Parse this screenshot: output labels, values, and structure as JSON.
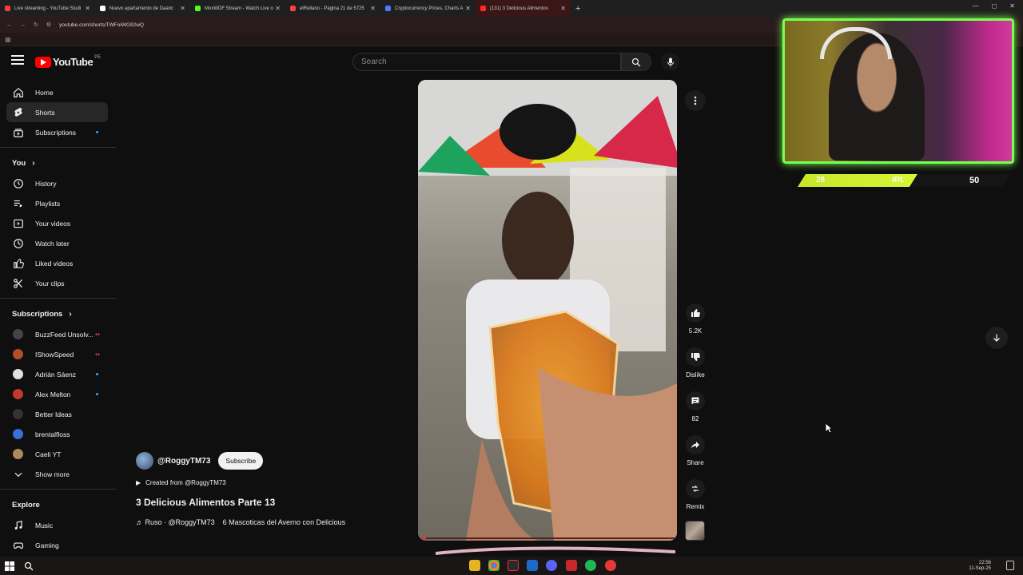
{
  "browser": {
    "tabs": [
      {
        "label": "Live streaming - YouTube Studi",
        "color": "#ff3b3b"
      },
      {
        "label": "Nuevo apartamento de Daaric",
        "color": "#ffffff"
      },
      {
        "label": "MoxWDF Stream - Watch Live o",
        "color": "#53fc18"
      },
      {
        "label": "elRellano - Página 21 de 5725",
        "color": "#ff4040"
      },
      {
        "label": "Cryptocurrency Prices, Charts A",
        "color": "#4f7cff"
      },
      {
        "label": "(131) 3 Delicious Alimentos",
        "color": "#ff2a2a"
      }
    ],
    "url": "youtube.com/shorts/TWFoiWG92wQ"
  },
  "header": {
    "logo_text": "YouTube",
    "country": "PE",
    "search_placeholder": "Search"
  },
  "sidebar": {
    "main": [
      {
        "label": "Home",
        "icon": "home-icon"
      },
      {
        "label": "Shorts",
        "icon": "shorts-icon",
        "active": true
      },
      {
        "label": "Subscriptions",
        "icon": "subscriptions-icon",
        "dot": true
      }
    ],
    "you_heading": "You",
    "you": [
      {
        "label": "History",
        "icon": "history-icon"
      },
      {
        "label": "Playlists",
        "icon": "playlists-icon"
      },
      {
        "label": "Your videos",
        "icon": "your-videos-icon"
      },
      {
        "label": "Watch later",
        "icon": "clock-icon"
      },
      {
        "label": "Liked videos",
        "icon": "thumbs-up-icon"
      },
      {
        "label": "Your clips",
        "icon": "scissors-icon"
      }
    ],
    "subs_heading": "Subscriptions",
    "subs": [
      {
        "label": "BuzzFeed Unsolv...",
        "color": "#444444",
        "live": true
      },
      {
        "label": "IShowSpeed",
        "color": "#b0502a",
        "live": true
      },
      {
        "label": "Adrián Sáenz",
        "color": "#e0e0e0",
        "dot": true
      },
      {
        "label": "Alex Melton",
        "color": "#c0392b",
        "dot": true
      },
      {
        "label": "Better Ideas",
        "color": "#333333"
      },
      {
        "label": "brentalfloss",
        "color": "#3a6fd8"
      },
      {
        "label": "Caeli YT",
        "color": "#b08a5a"
      }
    ],
    "show_more": "Show more",
    "explore_heading": "Explore",
    "explore": [
      {
        "label": "Music",
        "icon": "music-icon"
      },
      {
        "label": "Gaming",
        "icon": "gaming-icon"
      }
    ]
  },
  "short": {
    "channel": "@RoggyTM73",
    "subscribe": "Subscribe",
    "created_from": "Created from @RoggyTM73",
    "title": "3 Delicious Alimentos Parte 13",
    "audio_left": "♬ Ruso · @RoggyTM73",
    "audio_right": "6 Mascoticas del Averno con Delicious",
    "likes": "5.2K",
    "dislike": "Dislike",
    "comments": "82",
    "share": "Share",
    "remix": "Remix",
    "progress": 0.02
  },
  "overlay": {
    "score_left": "28",
    "score_mid": "IRL",
    "score_right": "50"
  },
  "taskbar": {
    "time": "22:56",
    "date": "11-Sep-25"
  }
}
